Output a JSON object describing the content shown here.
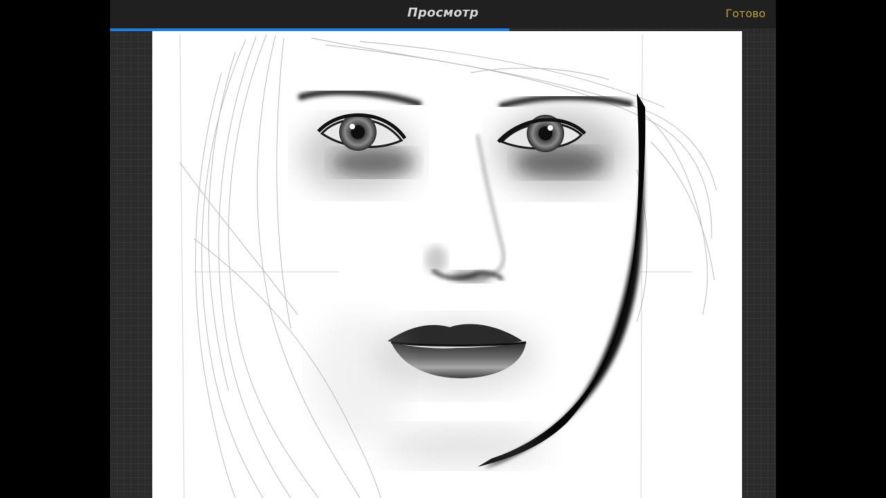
{
  "header": {
    "title": "Просмотр",
    "done_label": "Готово"
  },
  "progress": {
    "fraction": 0.6
  },
  "colors": {
    "accent": "#1e7ee6",
    "done_text": "#b8a23a",
    "toolbar_bg": "#202020",
    "workspace_bg": "#2b2b2b"
  },
  "canvas": {
    "subject": "pencil-portrait-drawing"
  }
}
